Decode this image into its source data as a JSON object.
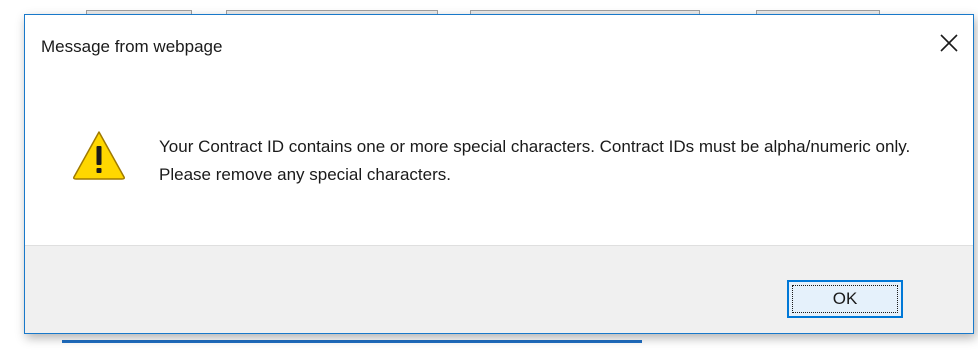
{
  "dialog": {
    "title": "Message from webpage",
    "close_icon": "close-icon",
    "warning_icon": "warning-icon",
    "message": "Your Contract ID contains one or more special characters. Contract IDs must be alpha/numeric only. Please remove any special characters.",
    "ok_label": "OK"
  },
  "colors": {
    "dialog_border": "#1979ca",
    "footer_bg": "#f0f0f0",
    "ok_border": "#0078d7",
    "ok_bg": "#e5f1fb",
    "warning_fill": "#ffd700"
  }
}
